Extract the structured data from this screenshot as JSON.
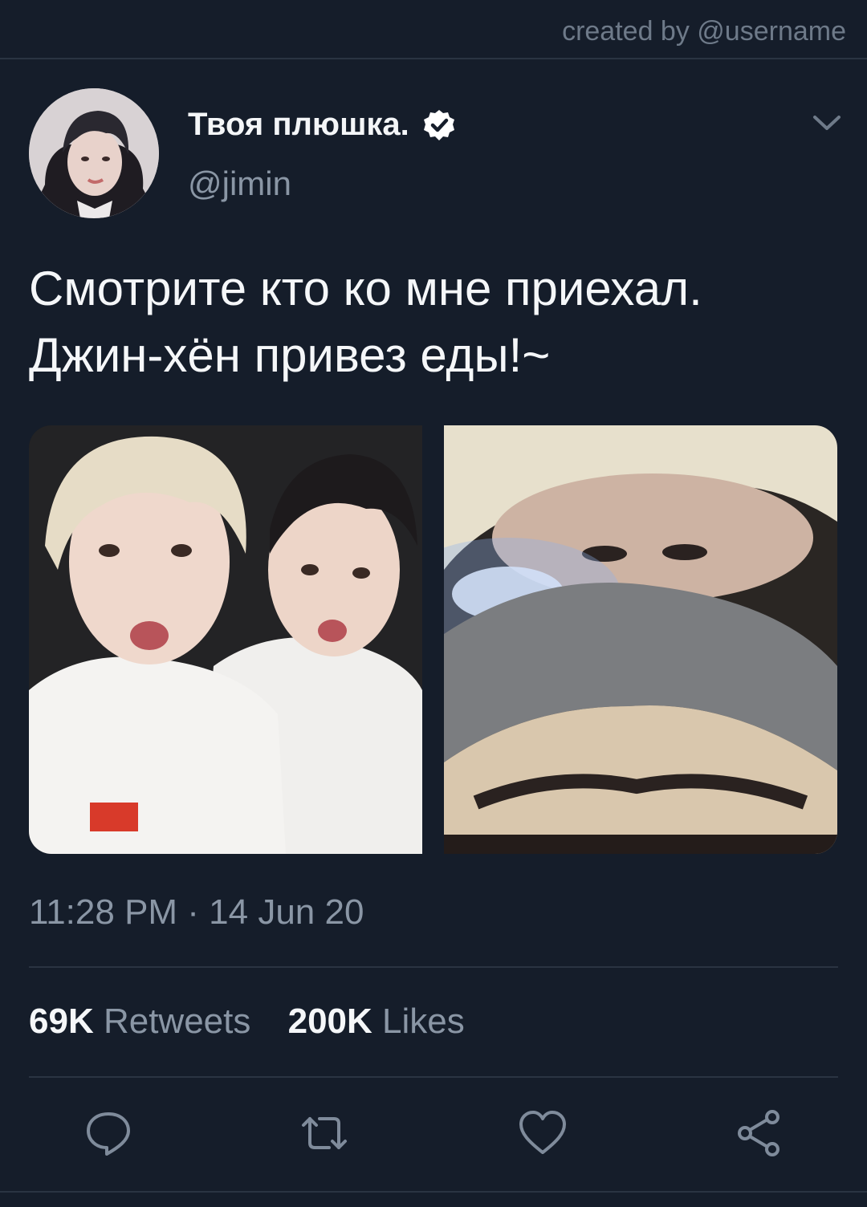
{
  "header": {
    "credit": "created by @username"
  },
  "tweet": {
    "display_name": "Твоя плюшка.",
    "handle": "@jimin",
    "text_line1": "Смотрите кто ко мне приехал.",
    "text_line2": "Джин-хён привез еды!~",
    "timestamp": "11:28 PM · 14 Jun 20",
    "retweets_count": "69K",
    "retweets_label": "Retweets",
    "likes_count": "200K",
    "likes_label": "Likes"
  },
  "icons": {
    "verified": "verified-badge-icon",
    "menu": "chevron-down-icon",
    "reply": "reply-icon",
    "retweet": "retweet-icon",
    "like": "heart-icon",
    "share": "share-icon"
  },
  "colors": {
    "background": "#151d2a",
    "divider": "#2a3442",
    "secondary_text": "#8a96a5",
    "primary_text": "#f5f7f9"
  }
}
